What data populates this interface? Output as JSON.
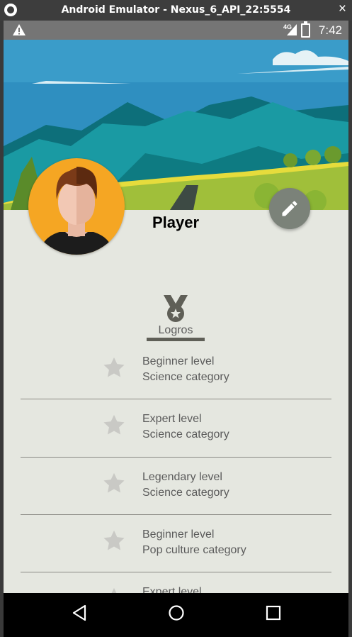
{
  "window": {
    "title": "Android Emulator - Nexus_6_API_22:5554",
    "close_glyph": "×"
  },
  "status_bar": {
    "network": "4G",
    "time": "7:42"
  },
  "profile": {
    "name": "Player"
  },
  "achievements": {
    "section_label": "Logros",
    "items": [
      {
        "level": "Beginner level",
        "category": "Science category"
      },
      {
        "level": "Expert level",
        "category": "Science category"
      },
      {
        "level": "Legendary level",
        "category": "Science category"
      },
      {
        "level": "Beginner level",
        "category": "Pop culture category"
      },
      {
        "level": "Expert level",
        "category": ""
      }
    ]
  },
  "colors": {
    "fab": "#7b8279",
    "avatar_bg": "#f5a623",
    "page_bg": "#e5e7e0",
    "star": "#c9c9c5"
  },
  "icons": [
    "warning-icon",
    "signal-icon",
    "battery-icon",
    "edit-icon",
    "medal-icon",
    "star-icon",
    "back-icon",
    "home-icon",
    "recents-icon"
  ]
}
